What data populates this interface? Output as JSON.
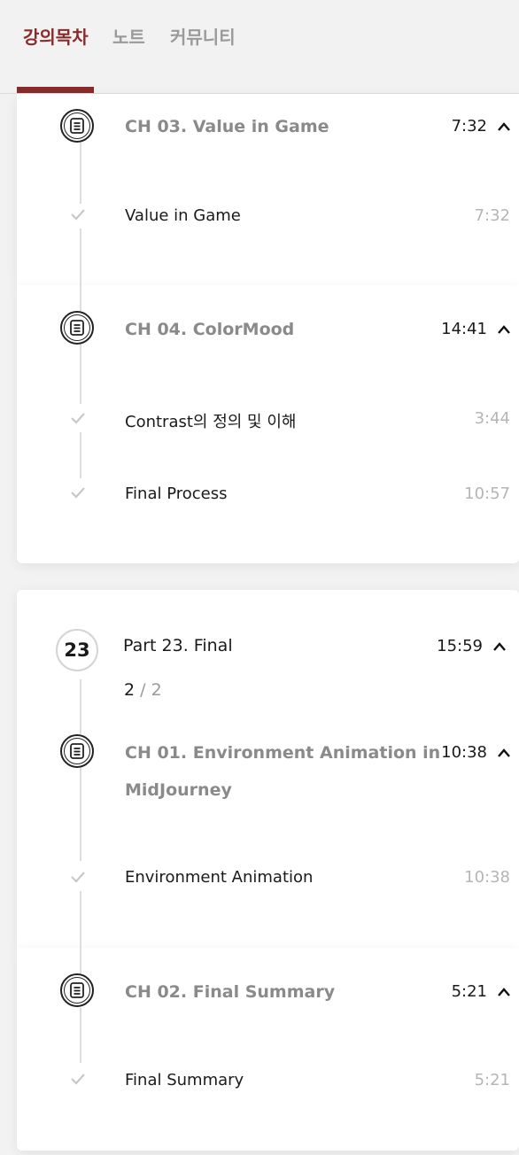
{
  "tabs": [
    {
      "label": "강의목차",
      "active": true
    },
    {
      "label": "노트",
      "active": false
    },
    {
      "label": "커뮤니티",
      "active": false
    }
  ],
  "chapters": {
    "ch03": {
      "title": "CH 03. Value in Game",
      "time": "7:32",
      "lessons": [
        {
          "title": "Value in Game",
          "time": "7:32"
        }
      ]
    },
    "ch04": {
      "title": "CH 04. ColorMood",
      "time": "14:41",
      "lessons": [
        {
          "title": "Contrast의 정의 및 이해",
          "time": "3:44"
        },
        {
          "title": "Final Process",
          "time": "10:57"
        }
      ]
    }
  },
  "part23": {
    "number": "23",
    "title": "Part 23. Final",
    "time": "15:59",
    "progress_done": "2",
    "progress_sep": "/",
    "progress_total": "2",
    "ch01": {
      "title_line1": "CH 01. Environment Animation in",
      "title_line2": "MidJourney",
      "time": "10:38",
      "lessons": [
        {
          "title": "Environment Animation",
          "time": "10:38"
        }
      ]
    },
    "ch02": {
      "title": "CH 02. Final Summary",
      "time": "5:21",
      "lessons": [
        {
          "title": "Final Summary",
          "time": "5:21"
        }
      ]
    }
  },
  "icons": {
    "chapter": "document-list-icon",
    "lesson_done": "check-icon",
    "collapse": "chevron-up-icon"
  },
  "colors": {
    "accent": "#8b2a2a",
    "muted": "#8a8a8a",
    "line": "#dedede"
  }
}
